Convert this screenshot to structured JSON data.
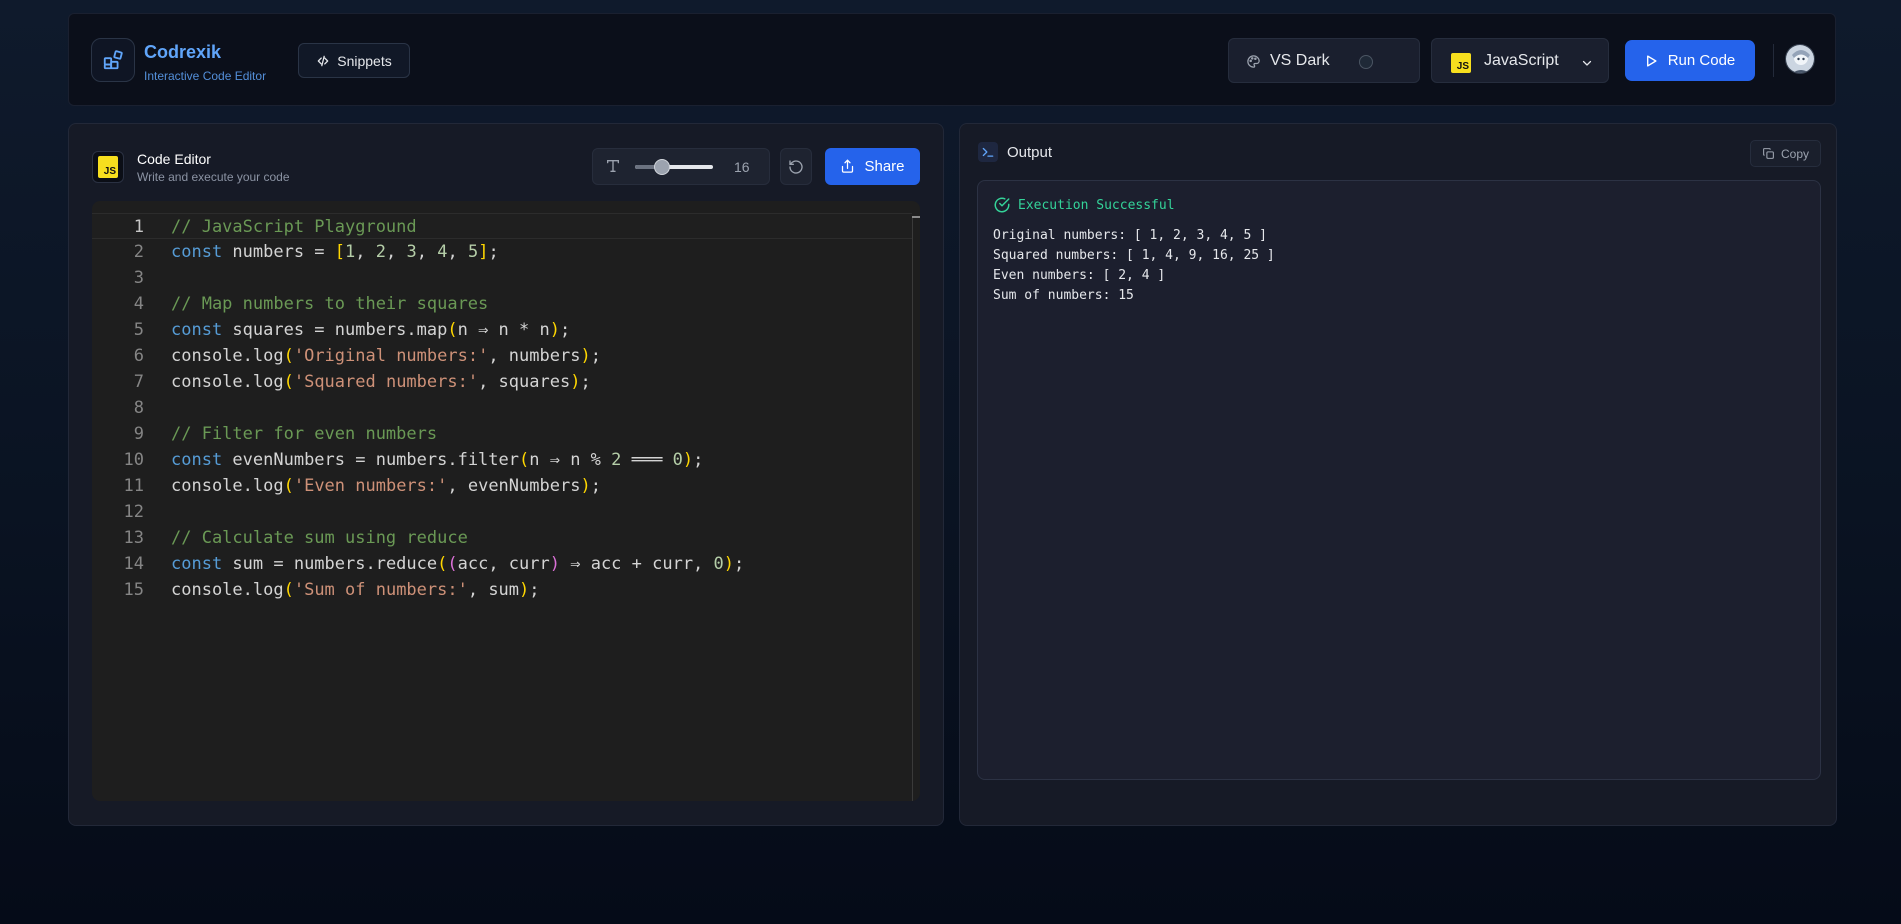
{
  "header": {
    "brand": {
      "name": "Codrexik",
      "subtitle": "Interactive Code Editor"
    },
    "snippets_label": "Snippets",
    "theme": {
      "selected": "VS Dark"
    },
    "language": {
      "selected": "JavaScript",
      "badge": "JS"
    },
    "run_label": "Run Code"
  },
  "editor": {
    "title": "Code Editor",
    "subtitle": "Write and execute your code",
    "badge": "JS",
    "font_size": "16",
    "font_size_fraction": 0.35,
    "share_label": "Share",
    "active_line": 1,
    "lines": [
      {
        "n": "1",
        "html": "<span class=\"cm\">// JavaScript Playground</span>"
      },
      {
        "n": "2",
        "html": "<span class=\"kw\">const</span> numbers = <span class=\"b1\">[</span><span class=\"nm\">1</span>, <span class=\"nm\">2</span>, <span class=\"nm\">3</span>, <span class=\"nm\">4</span>, <span class=\"nm\">5</span><span class=\"b1\">]</span>;"
      },
      {
        "n": "3",
        "html": ""
      },
      {
        "n": "4",
        "html": "<span class=\"cm\">// Map numbers to their squares</span>"
      },
      {
        "n": "5",
        "html": "<span class=\"kw\">const</span> squares = numbers.map<span class=\"b1\">(</span>n ⇒ n * n<span class=\"b1\">)</span>;"
      },
      {
        "n": "6",
        "html": "console.log<span class=\"b1\">(</span><span class=\"st\">'Original numbers:'</span>, numbers<span class=\"b1\">)</span>;"
      },
      {
        "n": "7",
        "html": "console.log<span class=\"b1\">(</span><span class=\"st\">'Squared numbers:'</span>, squares<span class=\"b1\">)</span>;"
      },
      {
        "n": "8",
        "html": ""
      },
      {
        "n": "9",
        "html": "<span class=\"cm\">// Filter for even numbers</span>"
      },
      {
        "n": "10",
        "html": "<span class=\"kw\">const</span> evenNumbers = numbers.filter<span class=\"b1\">(</span>n ⇒ n % <span class=\"nm\">2</span> ═══ <span class=\"nm\">0</span><span class=\"b1\">)</span>;"
      },
      {
        "n": "11",
        "html": "console.log<span class=\"b1\">(</span><span class=\"st\">'Even numbers:'</span>, evenNumbers<span class=\"b1\">)</span>;"
      },
      {
        "n": "12",
        "html": ""
      },
      {
        "n": "13",
        "html": "<span class=\"cm\">// Calculate sum using reduce</span>"
      },
      {
        "n": "14",
        "html": "<span class=\"kw\">const</span> sum = numbers.reduce<span class=\"b1\">(</span><span class=\"b2\">(</span>acc, curr<span class=\"b2\">)</span> ⇒ acc + curr, <span class=\"nm\">0</span><span class=\"b1\">)</span>;"
      },
      {
        "n": "15",
        "html": "console.log<span class=\"b1\">(</span><span class=\"st\">'Sum of numbers:'</span>, sum<span class=\"b1\">)</span>;"
      }
    ]
  },
  "output": {
    "title": "Output",
    "copy_label": "Copy",
    "status": "Execution Successful",
    "lines": [
      "Original numbers: [ 1, 2, 3, 4, 5 ]",
      "Squared numbers: [ 1, 4, 9, 16, 25 ]",
      "Even numbers: [ 2, 4 ]",
      "Sum of numbers: 15"
    ]
  },
  "colors": {
    "accent": "#2563eb",
    "brand": "#60a5fa",
    "success": "#34d399",
    "js_badge": "#f7df1e"
  },
  "icons": {
    "logo": "grid-blocks-icon",
    "snippets": "code-icon",
    "theme": "palette-icon",
    "language_chevron": "chevron-down-icon",
    "run": "play-icon",
    "font": "text-size-icon",
    "reset": "reset-icon",
    "share": "share-icon",
    "terminal": "terminal-icon",
    "copy": "copy-icon",
    "status": "check-circle-icon"
  }
}
